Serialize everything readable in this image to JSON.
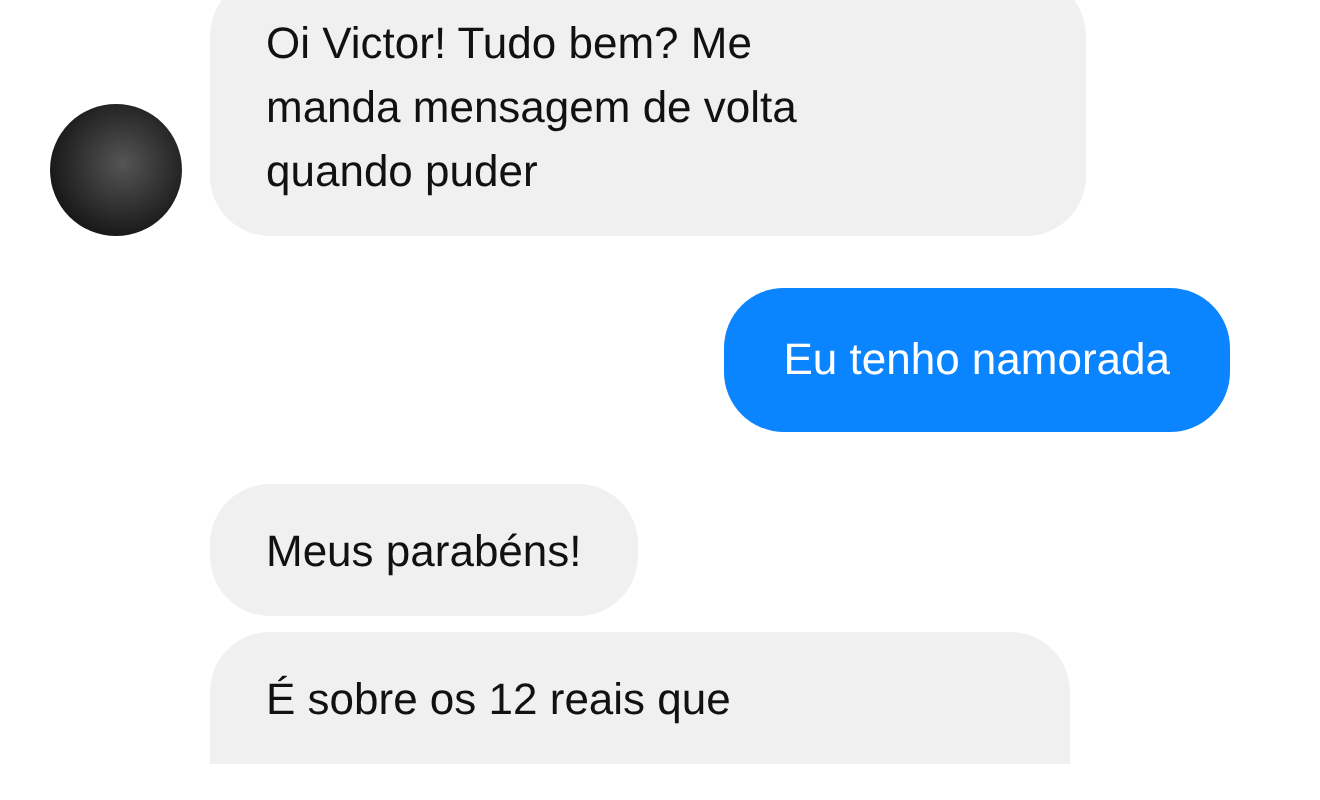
{
  "messages": [
    {
      "kind": "incoming",
      "text": "Oi Victor! Tudo bem? Me manda mensagem de volta quando puder",
      "avatar": true
    },
    {
      "kind": "outgoing",
      "text": "Eu tenho namorada",
      "avatar": false
    },
    {
      "kind": "incoming",
      "text": "Meus parabéns!",
      "avatar": false
    },
    {
      "kind": "incoming",
      "text": "É sobre os 12 reais que",
      "avatar": false
    }
  ]
}
